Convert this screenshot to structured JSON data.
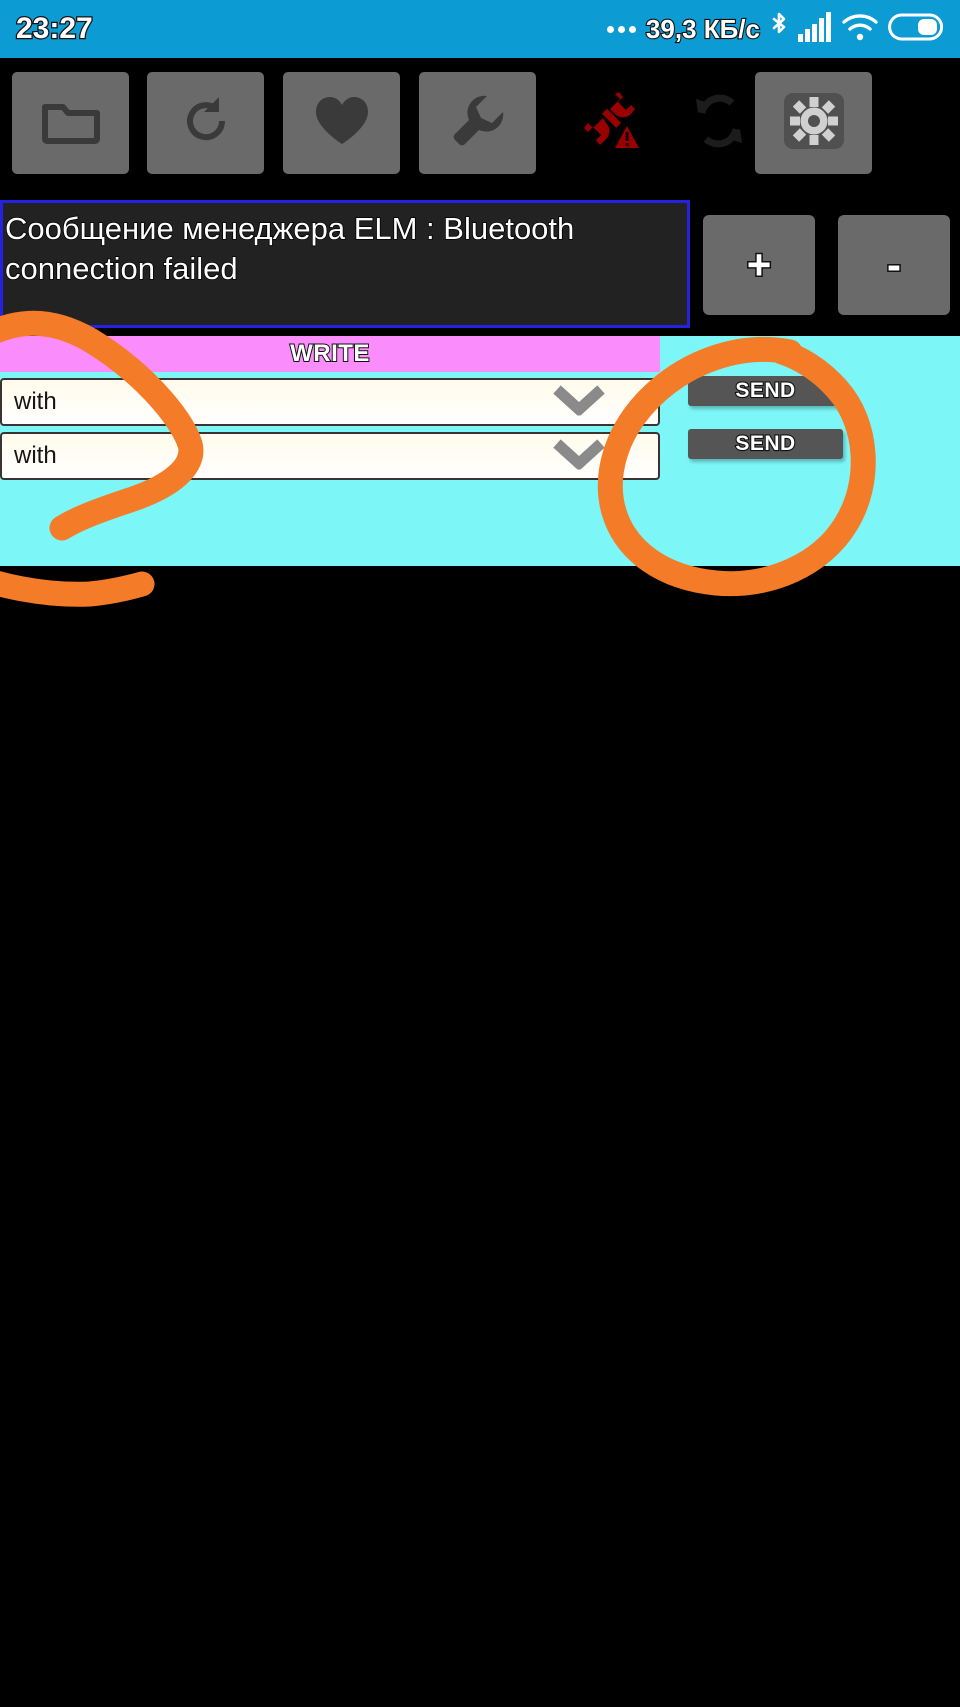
{
  "status_bar": {
    "time": "23:27",
    "network_speed": "39,3 КБ/c",
    "background_color": "#0C9BD3",
    "icons": [
      {
        "name": "overflow-dots-icon",
        "glyph": "..."
      },
      {
        "name": "bluetooth-icon",
        "glyph": "bluetooth"
      },
      {
        "name": "cellular-signal-icon",
        "glyph": "signal-bars"
      },
      {
        "name": "wifi-icon",
        "glyph": "wifi"
      },
      {
        "name": "battery-icon",
        "glyph": "battery-half"
      }
    ]
  },
  "toolbar": {
    "background_color": "#000000",
    "button_color": "#6a6a6a",
    "buttons": [
      {
        "name": "folder-button",
        "icon": "folder-icon",
        "has_background": true
      },
      {
        "name": "refresh-button",
        "icon": "refresh-icon",
        "has_background": true
      },
      {
        "name": "favorites-button",
        "icon": "heart-icon",
        "has_background": true
      },
      {
        "name": "tools-button",
        "icon": "wrench-icon",
        "has_background": true
      },
      {
        "name": "connection-status",
        "icon": "disconnected-plug-warning-icon",
        "has_background": false,
        "color": "#990000"
      },
      {
        "name": "sync-button",
        "icon": "sync-arrows-icon",
        "has_background": false,
        "color": "#1a1a1a"
      },
      {
        "name": "settings-button",
        "icon": "gear-icon",
        "has_background": true
      }
    ]
  },
  "message_box": {
    "text": "Сообщение менеджера ELM : Bluetooth connection failed",
    "border_color": "#2422DE",
    "background_color": "#222222",
    "text_color": "#FFFFFF"
  },
  "zoom_controls": {
    "increase_label": "+",
    "decrease_label": "-"
  },
  "write_panel": {
    "background_color": "#7CF6F6",
    "header": {
      "label": "WRITE",
      "background_color": "#FB8CFC"
    },
    "rows": [
      {
        "dropdown_value": "with",
        "send_label": "SEND"
      },
      {
        "dropdown_value": "with",
        "send_label": "SEND"
      }
    ]
  },
  "annotations": {
    "color": "#F47B28",
    "shapes": [
      {
        "name": "left-hook-annotation",
        "description": "hand-drawn hook around dropdown fields"
      },
      {
        "name": "left-underline-annotation",
        "description": "hand-drawn stroke below panel"
      },
      {
        "name": "right-circle-annotation",
        "description": "hand-drawn circle around SEND buttons"
      }
    ]
  }
}
